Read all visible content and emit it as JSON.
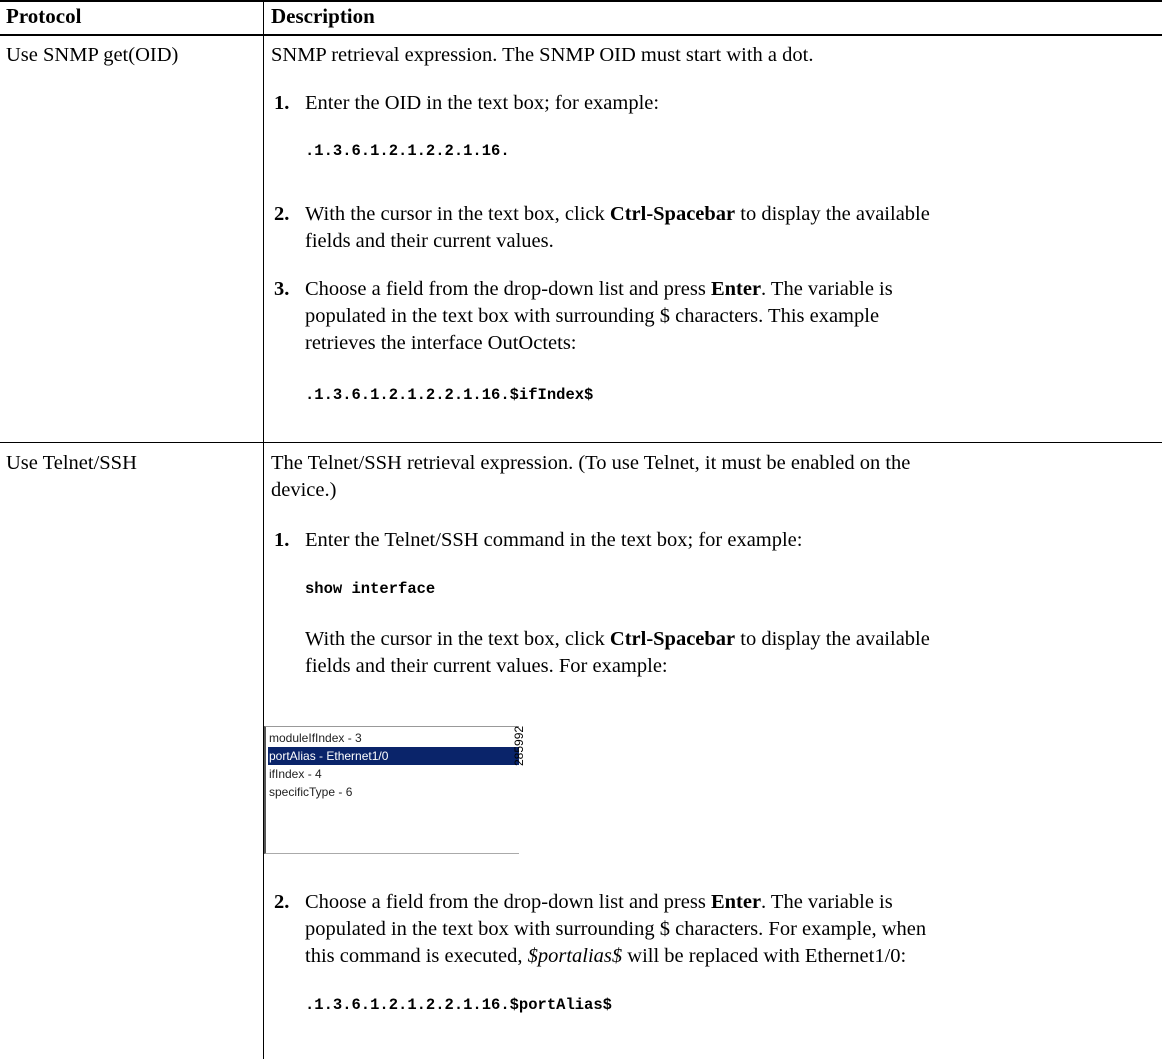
{
  "table": {
    "headers": [
      "Protocol",
      "Description"
    ],
    "rows": [
      {
        "protocol": "Use SNMP get(OID)",
        "description": "SNMP retrieval expression. The SNMP OID must start with a dot.",
        "steps": [
          {
            "num": "1.",
            "text": "Enter the OID in the text box; for example:",
            "code": ".1.3.6.1.2.1.2.2.1.16."
          },
          {
            "num": "2.",
            "line1_pre": "With the cursor in the text box, click ",
            "line1_bold": "Ctrl-Spacebar",
            "line1_post": " to display the available",
            "line2": "fields and their current values."
          },
          {
            "num": "3.",
            "line1_pre": "Choose a field from the drop-down list and press ",
            "line1_bold": "Enter",
            "line1_post": ". The variable is",
            "line2": "populated in the text box with surrounding $ characters. This example",
            "line3": "retrieves the interface OutOctets:",
            "code": ".1.3.6.1.2.1.2.2.1.16.$ifIndex$"
          }
        ]
      },
      {
        "protocol": "Use Telnet/SSH",
        "description_line1": "The Telnet/SSH retrieval expression. (To use Telnet, it must be enabled on the",
        "description_line2": "device.)",
        "steps": [
          {
            "num": "1.",
            "text": "Enter the Telnet/SSH command in the text box; for example:",
            "code": "show interface",
            "follow_pre": "With the cursor in the text box, click ",
            "follow_bold": "Ctrl-Spacebar",
            "follow_post": " to display the available",
            "follow_line2": "fields and their current values. For example:"
          },
          {
            "num": "2.",
            "line1_pre": "Choose a field from the drop-down list and press ",
            "line1_bold": "Enter",
            "line1_post": ". The variable is",
            "line2": "populated in the text box with surrounding $ characters. For example, when",
            "line3_pre": "this command is executed, ",
            "line3_italic": "$portalias$",
            "line3_post": " will be replaced with Ethernet1/0:",
            "code": ".1.3.6.1.2.1.2.2.1.16.$portAlias$"
          }
        ]
      }
    ]
  },
  "dropdown": {
    "items": [
      "moduleIfIndex - 3",
      "portAlias - Ethernet1/0",
      "ifIndex - 4",
      "specificType - 6"
    ],
    "selected_index": 1,
    "figure_id": "285992"
  }
}
